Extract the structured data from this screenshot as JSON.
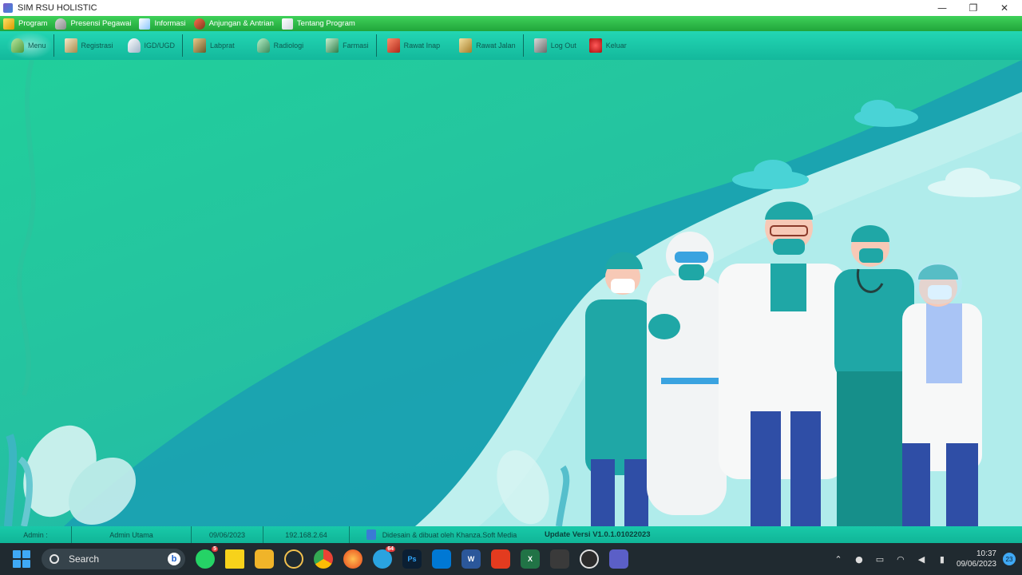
{
  "window": {
    "title": "SIM RSU HOLISTIC",
    "controls": [
      "minimize",
      "maximize",
      "close"
    ]
  },
  "menubar": {
    "items": [
      {
        "label": "Program",
        "icon": "key-icon"
      },
      {
        "label": "Presensi Pegawai",
        "icon": "person-icon"
      },
      {
        "label": "Informasi",
        "icon": "info-icon"
      },
      {
        "label": "Anjungan & Antrian",
        "icon": "people-icon"
      },
      {
        "label": "Tentang Program",
        "icon": "document-icon"
      }
    ]
  },
  "toolbar": {
    "items": [
      {
        "label": "Menu",
        "icon": "home-icon"
      },
      {
        "label": "Registrasi",
        "icon": "registration-icon"
      },
      {
        "label": "IGD/UGD",
        "icon": "emergency-icon"
      },
      {
        "label": "Labprat",
        "icon": "lab-icon"
      },
      {
        "label": "Radiologi",
        "icon": "radiology-icon"
      },
      {
        "label": "Farmasi",
        "icon": "pharmacy-icon"
      },
      {
        "label": "Rawat Inap",
        "icon": "hospital-icon"
      },
      {
        "label": "Rawat Jalan",
        "icon": "outpatient-icon"
      },
      {
        "label": "Log Out",
        "icon": "logout-icon"
      },
      {
        "label": "Keluar",
        "icon": "exit-icon"
      }
    ]
  },
  "statusbar": {
    "admin": "Admin :",
    "role": "Admin Utama",
    "date": "09/06/2023",
    "ip": "192.168.2.64",
    "credit": "Didesain & dibuat oleh Khanza.Soft Media",
    "version": "Update Versi V1.0.1.01022023"
  },
  "taskbar": {
    "search_placeholder": "Search",
    "apps": [
      {
        "name": "whatsapp-app",
        "badge": "5"
      },
      {
        "name": "sticky-notes-app",
        "badge": ""
      },
      {
        "name": "file-explorer-app",
        "badge": ""
      },
      {
        "name": "paint-app",
        "badge": ""
      },
      {
        "name": "chrome-app",
        "badge": ""
      },
      {
        "name": "firefox-app",
        "badge": ""
      },
      {
        "name": "telegram-app",
        "badge": "64"
      },
      {
        "name": "photoshop-app",
        "badge": ""
      },
      {
        "name": "vscode-app",
        "badge": ""
      },
      {
        "name": "word-app",
        "badge": ""
      },
      {
        "name": "acrobat-app",
        "badge": ""
      },
      {
        "name": "excel-app",
        "badge": ""
      },
      {
        "name": "terminal-app",
        "badge": ""
      },
      {
        "name": "obs-app",
        "badge": ""
      },
      {
        "name": "java-app",
        "badge": ""
      }
    ],
    "app_labels": {
      "photoshop": "Ps",
      "word": "W",
      "excel": "X"
    },
    "clock_time": "10:37",
    "clock_date": "09/06/2023",
    "notification_count": "23"
  },
  "colors": {
    "menubar": "#21a53a",
    "toolbar": "#13b89c",
    "background_start": "#21cf9b",
    "background_end": "#1aaeb0",
    "taskbar": "#202a30"
  }
}
